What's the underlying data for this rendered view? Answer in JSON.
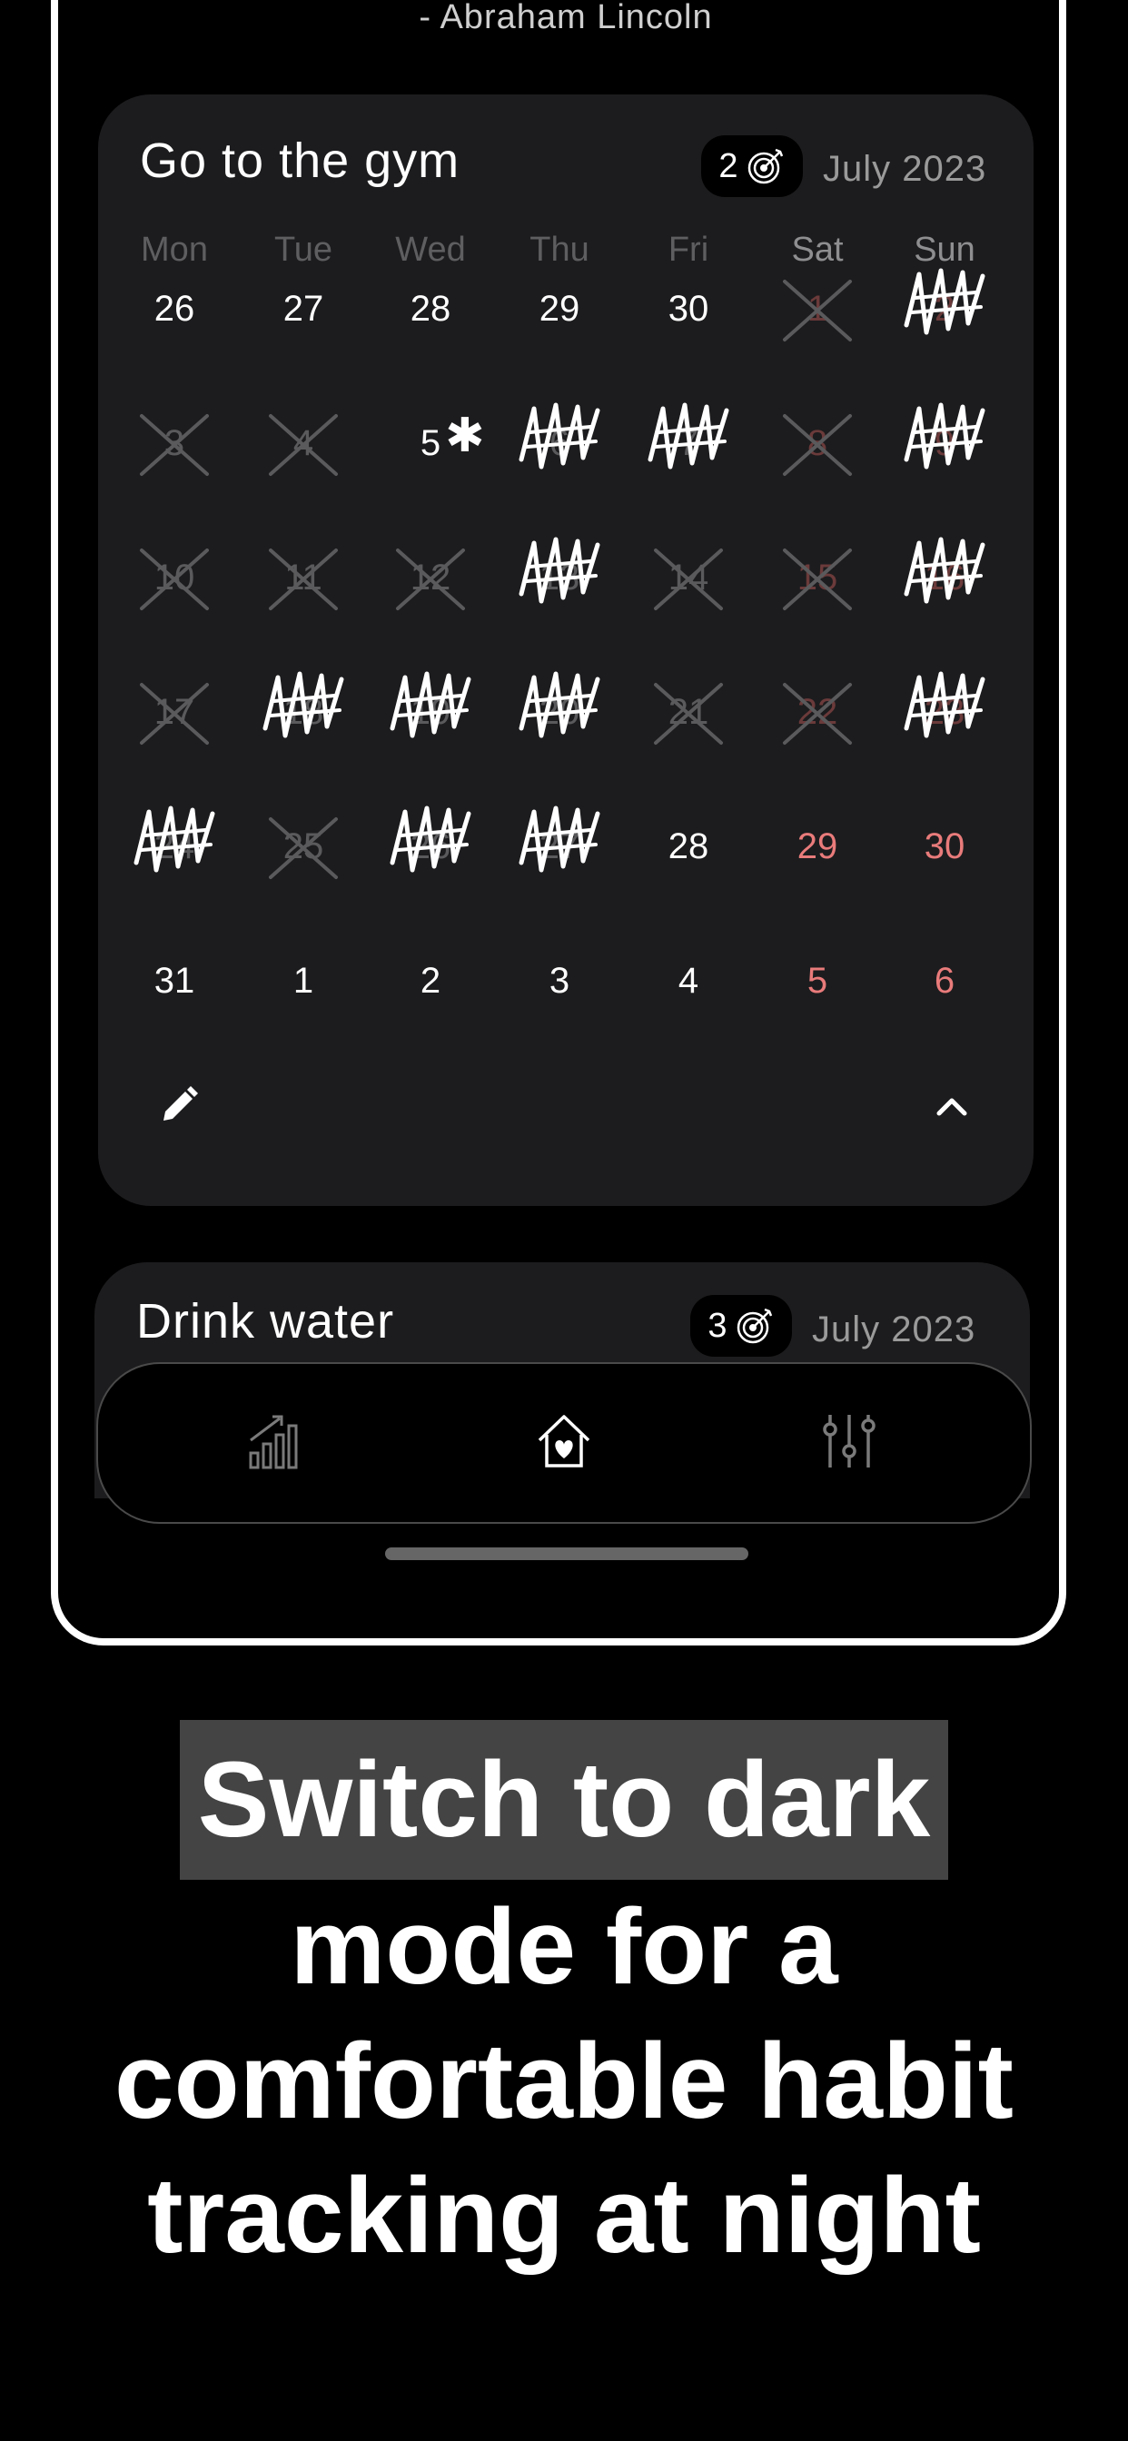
{
  "quote_author": "- Abraham Lincoln",
  "habits": [
    {
      "title": "Go to the gym",
      "streak": "2",
      "month": "July 2023",
      "weekdays": [
        "Mon",
        "Tue",
        "Wed",
        "Thu",
        "Fri",
        "Sat",
        "Sun"
      ],
      "days": [
        {
          "n": "26",
          "mark": "none"
        },
        {
          "n": "27",
          "mark": "none"
        },
        {
          "n": "28",
          "mark": "none"
        },
        {
          "n": "29",
          "mark": "none"
        },
        {
          "n": "30",
          "mark": "none"
        },
        {
          "n": "1",
          "mark": "x"
        },
        {
          "n": "2",
          "mark": "scribble"
        },
        {
          "n": "3",
          "mark": "x"
        },
        {
          "n": "4",
          "mark": "x"
        },
        {
          "n": "5",
          "mark": "star"
        },
        {
          "n": "6",
          "mark": "scribble"
        },
        {
          "n": "7",
          "mark": "scribble"
        },
        {
          "n": "8",
          "mark": "x"
        },
        {
          "n": "9",
          "mark": "scribble"
        },
        {
          "n": "10",
          "mark": "x"
        },
        {
          "n": "11",
          "mark": "x"
        },
        {
          "n": "12",
          "mark": "x"
        },
        {
          "n": "13",
          "mark": "scribble"
        },
        {
          "n": "14",
          "mark": "x"
        },
        {
          "n": "15",
          "mark": "x"
        },
        {
          "n": "16",
          "mark": "scribble"
        },
        {
          "n": "17",
          "mark": "x"
        },
        {
          "n": "18",
          "mark": "scribble"
        },
        {
          "n": "19",
          "mark": "scribble"
        },
        {
          "n": "20",
          "mark": "scribble"
        },
        {
          "n": "21",
          "mark": "x"
        },
        {
          "n": "22",
          "mark": "x"
        },
        {
          "n": "23",
          "mark": "scribble"
        },
        {
          "n": "24",
          "mark": "scribble"
        },
        {
          "n": "25",
          "mark": "x"
        },
        {
          "n": "26",
          "mark": "scribble"
        },
        {
          "n": "27",
          "mark": "scribble"
        },
        {
          "n": "28",
          "mark": "none"
        },
        {
          "n": "29",
          "mark": "none"
        },
        {
          "n": "30",
          "mark": "none"
        },
        {
          "n": "31",
          "mark": "none"
        },
        {
          "n": "1",
          "mark": "none"
        },
        {
          "n": "2",
          "mark": "none"
        },
        {
          "n": "3",
          "mark": "none"
        },
        {
          "n": "4",
          "mark": "none"
        },
        {
          "n": "5",
          "mark": "none"
        },
        {
          "n": "6",
          "mark": "none"
        }
      ]
    },
    {
      "title": "Drink water",
      "streak": "3",
      "month": "July 2023"
    }
  ],
  "icons": {
    "streak": "target-icon",
    "edit": "pencil-icon",
    "collapse": "chevron-up-icon",
    "nav": [
      "stats-icon",
      "home-heart-icon",
      "settings-sliders-icon"
    ]
  },
  "caption": {
    "highlight": "Switch to dark",
    "line2": "mode for a",
    "line3": "comfortable habit",
    "line4": "tracking at night"
  }
}
